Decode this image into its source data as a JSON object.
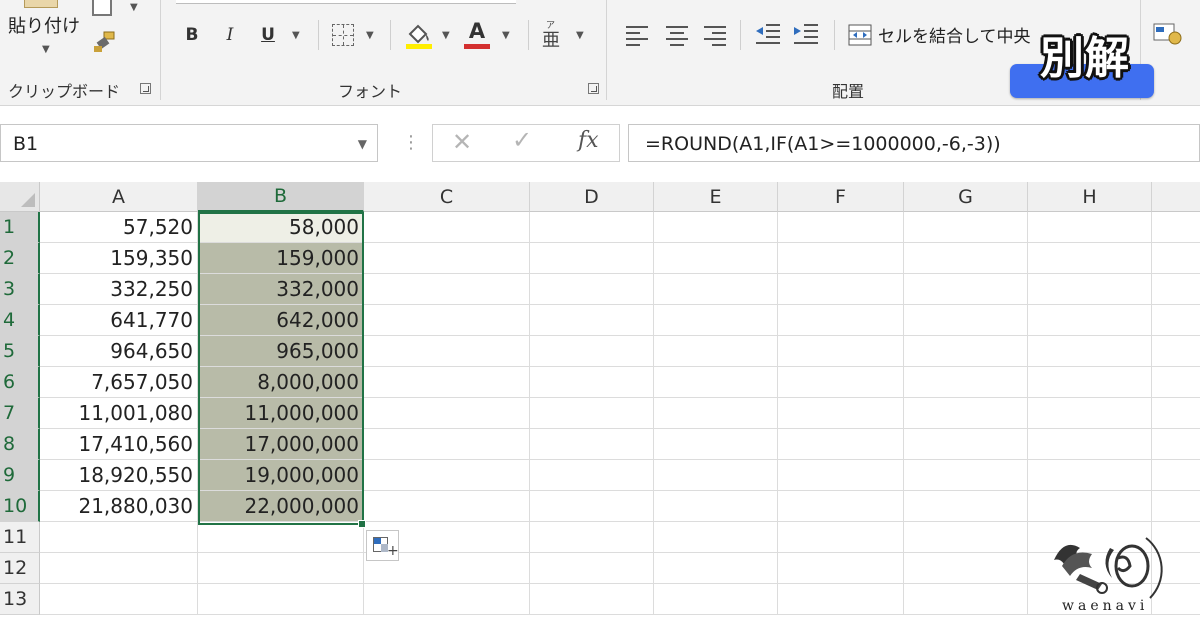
{
  "ribbon": {
    "clipboard": {
      "paste_label": "貼り付け",
      "group_label": "クリップボード"
    },
    "font": {
      "bold": "B",
      "italic": "I",
      "underline": "U",
      "font_color": "A",
      "group_label": "フォント",
      "font_color_hex": "#d32f2f",
      "fill_color_hex": "#ffee00"
    },
    "alignment": {
      "merge_label": "セルを結合して中央",
      "group_label": "配置"
    },
    "overlay_title": "別解",
    "overlay_button_color": "#3f6ff0"
  },
  "formula_bar": {
    "name_box": "B1",
    "fx_label": "fx",
    "formula": "=ROUND(A1,IF(A1>=1000000,-6,-3))"
  },
  "grid": {
    "columns": [
      "A",
      "B",
      "C",
      "D",
      "E",
      "F",
      "G",
      "H"
    ],
    "rows": [
      "1",
      "2",
      "3",
      "4",
      "5",
      "6",
      "7",
      "8",
      "9",
      "10",
      "11",
      "12",
      "13"
    ],
    "col_a": [
      "57,520",
      "159,350",
      "332,250",
      "641,770",
      "964,650",
      "7,657,050",
      "11,001,080",
      "17,410,560",
      "18,920,550",
      "21,880,030"
    ],
    "col_b": [
      "58,000",
      "159,000",
      "332,000",
      "642,000",
      "965,000",
      "8,000,000",
      "11,000,000",
      "17,000,000",
      "19,000,000",
      "22,000,000"
    ],
    "selected_column": "B",
    "selection_color": "#217346"
  },
  "watermark": {
    "text": "waenavi"
  }
}
